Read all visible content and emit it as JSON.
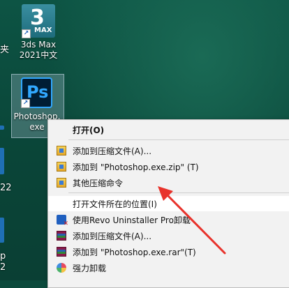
{
  "desktop": {
    "icons": [
      {
        "id": "3dsmax",
        "label_line1": "3ds Max",
        "label_line2": "2021中文",
        "glyph": "3",
        "badge": "MAX"
      },
      {
        "id": "photoshop",
        "label_line1": "Photoshop.",
        "label_line2": "exe",
        "glyph": "Ps"
      }
    ],
    "left_edge": {
      "top_char": "夹",
      "mid_char": "22",
      "low_char_1": "p",
      "low_char_2": "2"
    }
  },
  "context_menu": {
    "items": [
      {
        "label": "打开(O)",
        "icon": "none",
        "bold": true
      },
      {
        "label": "添加到压缩文件(A)...",
        "icon": "compress-archive-icon"
      },
      {
        "label": "添加到 \"Photoshop.exe.zip\" (T)",
        "icon": "compress-archive-icon"
      },
      {
        "label": "其他压缩命令",
        "icon": "compress-archive-icon",
        "submenu_glyph": "›"
      },
      {
        "label": "打开文件所在的位置(I)",
        "icon": "none"
      },
      {
        "label": "使用Revo Uninstaller Pro卸载",
        "icon": "revo-uninstaller-icon"
      },
      {
        "label": "添加到压缩文件(A)...",
        "icon": "winrar-icon"
      },
      {
        "label": "添加到 \"Photoshop.exe.rar\"(T)",
        "icon": "winrar-icon"
      },
      {
        "label": "强力卸载",
        "icon": "uninstall-icon"
      }
    ]
  },
  "colors": {
    "annotation_arrow": "#e8322b",
    "menu_bg": "#f2f2f2"
  }
}
